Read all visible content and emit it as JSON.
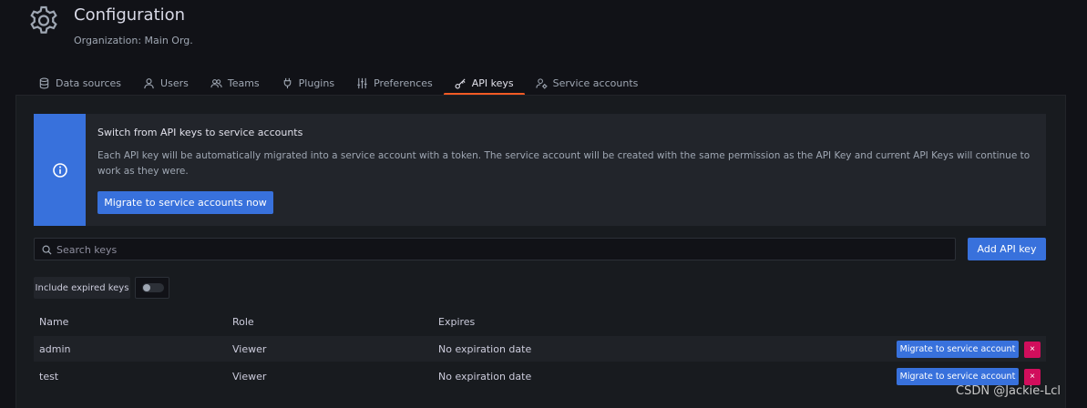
{
  "header": {
    "title": "Configuration",
    "subtitle": "Organization: Main Org."
  },
  "tabs": [
    {
      "label": "Data sources",
      "icon": "database-icon"
    },
    {
      "label": "Users",
      "icon": "user-icon"
    },
    {
      "label": "Teams",
      "icon": "users-icon"
    },
    {
      "label": "Plugins",
      "icon": "plug-icon"
    },
    {
      "label": "Preferences",
      "icon": "sliders-icon"
    },
    {
      "label": "API keys",
      "icon": "key-icon",
      "active": true
    },
    {
      "label": "Service accounts",
      "icon": "user-cog-icon"
    }
  ],
  "alert": {
    "title": "Switch from API keys to service accounts",
    "text": "Each API key will be automatically migrated into a service account with a token. The service account will be created with the same permission as the API Key and current API Keys will continue to work as they were.",
    "button_label": "Migrate to service accounts now"
  },
  "search": {
    "placeholder": "Search keys"
  },
  "add_button_label": "Add API key",
  "toggle": {
    "label": "Include expired keys",
    "on": false
  },
  "table": {
    "headers": [
      "Name",
      "Role",
      "Expires"
    ],
    "rows": [
      {
        "name": "admin",
        "role": "Viewer",
        "expires": "No expiration date"
      },
      {
        "name": "test",
        "role": "Viewer",
        "expires": "No expiration date"
      }
    ],
    "migrate_label": "Migrate to service account",
    "delete_label": "×"
  },
  "watermark": "CSDN @Jackie-Lcl",
  "colors": {
    "accent": "#3871dc",
    "active_tab_underline": "#f15a24",
    "danger": "#d10e5c",
    "background": "#111217"
  }
}
